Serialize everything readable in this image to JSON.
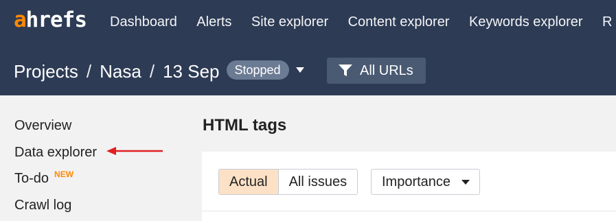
{
  "brand": {
    "logo_a": "a",
    "logo_rest": "hrefs",
    "accent_color": "#ff8800",
    "header_bg": "#2d3b55"
  },
  "nav": {
    "items": [
      "Dashboard",
      "Alerts",
      "Site explorer",
      "Content explorer",
      "Keywords explorer",
      "R"
    ]
  },
  "breadcrumb": {
    "projects": "Projects",
    "separator": "/",
    "project": "Nasa",
    "crawl": "13 Sep",
    "status": "Stopped"
  },
  "filter": {
    "label": "All URLs",
    "icon": "filter-icon"
  },
  "sidebar": {
    "items": [
      "Overview",
      "Data explorer",
      "To-do",
      "Crawl log"
    ],
    "new_badge": "NEW"
  },
  "main": {
    "title": "HTML tags",
    "segments": [
      "Actual",
      "All issues"
    ],
    "active_segment": "Actual",
    "importance_label": "Importance"
  },
  "annotation": {
    "arrow_color": "#e02020",
    "points_to": "Data explorer"
  }
}
